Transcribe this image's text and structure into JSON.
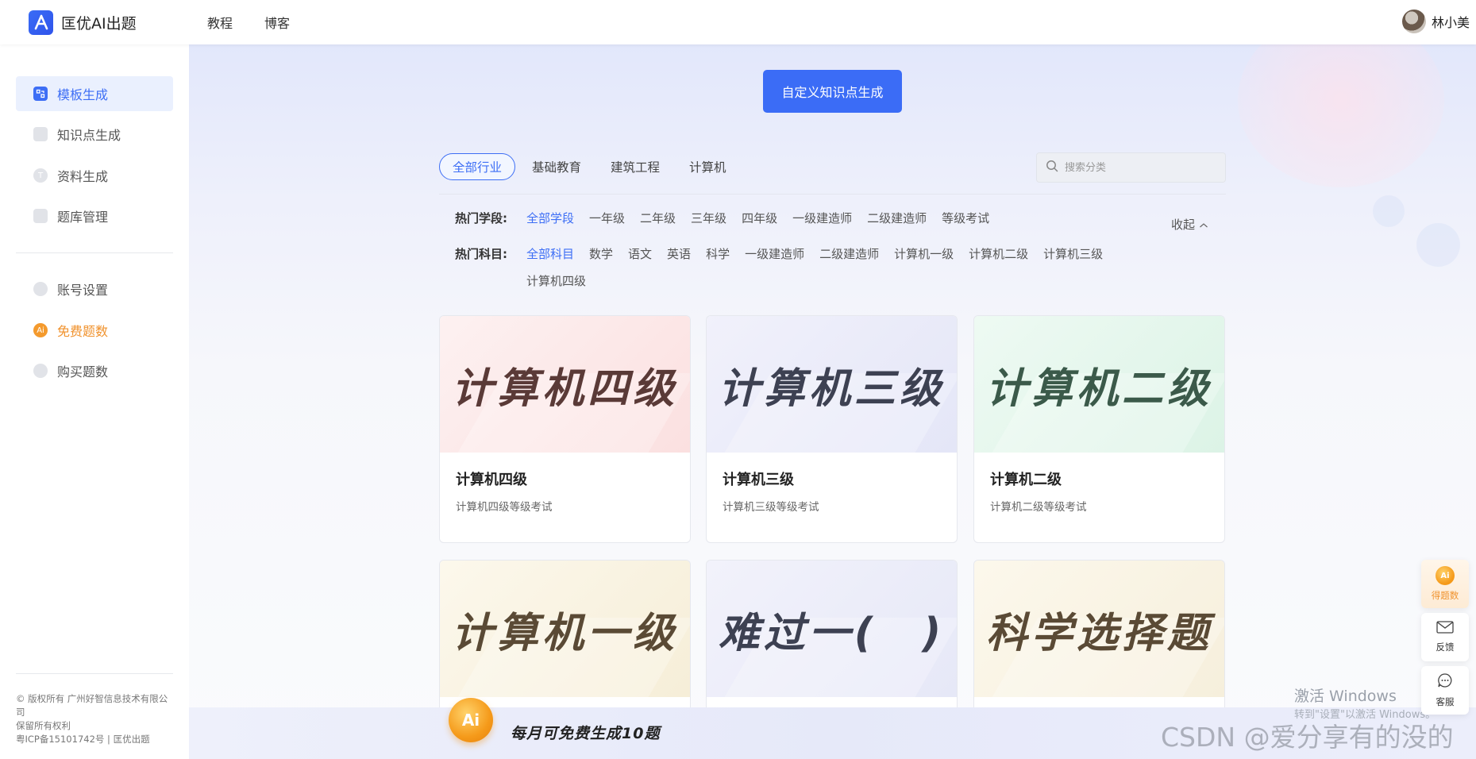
{
  "app": {
    "name": "匡优AI出题",
    "nav": [
      "教程",
      "博客"
    ],
    "user_name": "林小美"
  },
  "sidebar": {
    "items": [
      {
        "label": "模板生成",
        "icon": "template-icon",
        "active": true
      },
      {
        "label": "知识点生成",
        "icon": "knowledge-icon"
      },
      {
        "label": "资料生成",
        "icon": "material-icon"
      },
      {
        "label": "题库管理",
        "icon": "question-bank-icon"
      },
      {
        "label": "账号设置",
        "icon": "user-icon"
      },
      {
        "label": "免费题数",
        "icon": "coin-icon",
        "accent": "#f0922d"
      },
      {
        "label": "购买题数",
        "icon": "diamond-icon"
      }
    ],
    "footer": {
      "copyright": "© 版权所有 广州好智信息技术有限公司",
      "rights": "保留所有权利",
      "icp": "粤ICP备15101742号 | 匡优出题"
    }
  },
  "main": {
    "custom_button": "自定义知识点生成",
    "industry_tabs": [
      "全部行业",
      "基础教育",
      "建筑工程",
      "计算机"
    ],
    "search_placeholder": "搜索分类",
    "stage_filter": {
      "label": "热门学段:",
      "items": [
        "全部学段",
        "一年级",
        "二年级",
        "三年级",
        "四年级",
        "一级建造师",
        "二级建造师",
        "等级考试"
      ]
    },
    "subject_filter": {
      "label": "热门科目:",
      "items": [
        "全部科目",
        "数学",
        "语文",
        "英语",
        "科学",
        "一级建造师",
        "二级建造师",
        "计算机一级",
        "计算机二级",
        "计算机三级",
        "计算机四级"
      ]
    },
    "collapse_label": "收起",
    "cards": [
      {
        "cover": "计算机四级",
        "title": "计算机四级",
        "desc": "计算机四级等级考试"
      },
      {
        "cover": "计算机三级",
        "title": "计算机三级",
        "desc": "计算机三级等级考试"
      },
      {
        "cover": "计算机二级",
        "title": "计算机二级",
        "desc": "计算机二级等级考试"
      },
      {
        "cover": "计算机一级"
      },
      {
        "cover": "难过一(　)"
      },
      {
        "cover": "科学选择题"
      }
    ]
  },
  "banner": {
    "coin_text": "Ai",
    "text": "每月可免费生成10题"
  },
  "float_panel": {
    "coin_label": "得题数",
    "coin_text": "Ai",
    "feedback_label": "反馈",
    "service_label": "客服"
  },
  "watermarks": {
    "windows_title": "激活 Windows",
    "windows_sub": "转到\"设置\"以激活 Windows。",
    "csdn": "CSDN @爱分享有的没的"
  },
  "colors": {
    "primary": "#3b6cf6",
    "accent_orange": "#f0922d"
  }
}
